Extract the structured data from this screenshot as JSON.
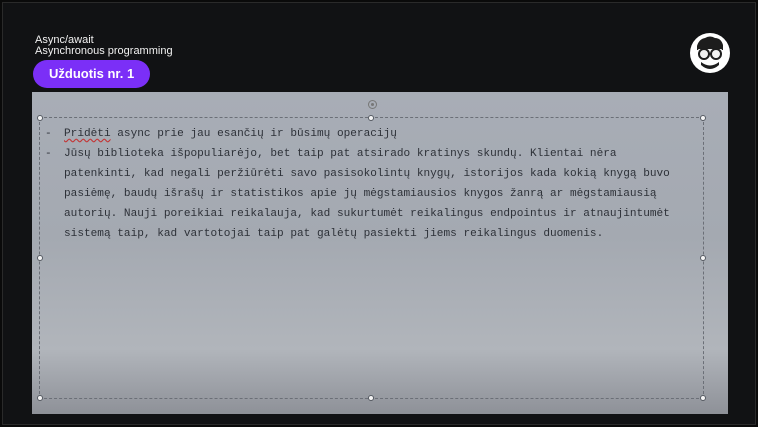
{
  "header": {
    "topic_title": "Async/await",
    "topic_subtitle": "Asynchronous programming",
    "badge_label": "Užduotis nr. 1"
  },
  "colors": {
    "background": "#111214",
    "badge": "#7b2ff7",
    "panel": "#a8adb6",
    "text": "#2d3138"
  },
  "logo": {
    "icon": "nerd-glasses-avatar-icon"
  },
  "tasks": [
    {
      "marked_word": "Pridėti",
      "rest": " async prie jau esančių ir būsimų operacijų"
    },
    {
      "text": "Jūsų biblioteka išpopuliarėjo, bet taip pat atsirado kratinys skundų. Klientai nėra patenkinti, kad negali peržiūrėti savo pasisokolintų knygų, istorijos kada kokią knygą buvo pasiėmę, baudų išrašų ir statistikos apie jų mėgstamiausios knygos žanrą ar mėgstamiausią autorių. Nauji poreikiai reikalauja, kad sukurtumėt reikalingus endpointus ir atnaujintumėt sistemą taip, kad vartotojai taip pat galėtų pasiekti jiems reikalingus duomenis."
    }
  ]
}
